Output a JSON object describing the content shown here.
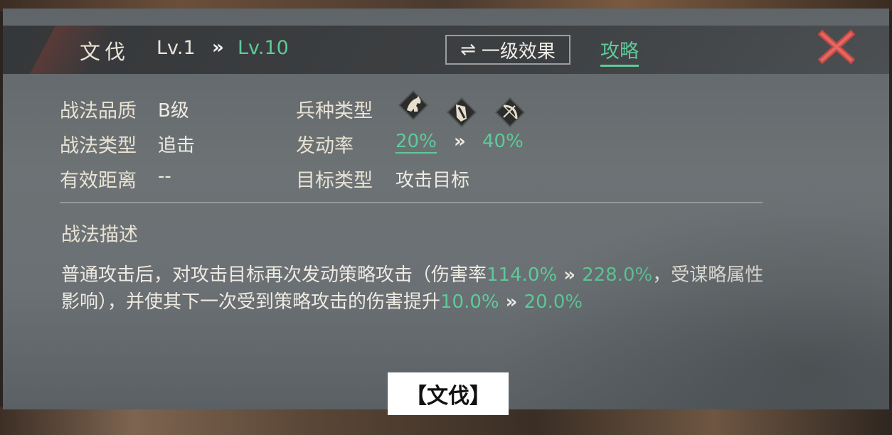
{
  "header": {
    "skill_name": "文伐",
    "level_from": "Lv.1",
    "level_arrow": "»",
    "level_to": "Lv.10",
    "effect_button": {
      "icon": "⇌",
      "label": "一级效果"
    },
    "strategy_link": "攻略",
    "close_icon": "close-icon"
  },
  "attributes": {
    "quality_label": "战法品质",
    "quality_value": "B级",
    "type_label": "战法类型",
    "type_value": "追击",
    "range_label": "有效距离",
    "range_value": "--",
    "troop_label": "兵种类型",
    "troop_icons": [
      "cavalry-icon",
      "shield-icon",
      "archer-icon"
    ],
    "rate_label": "发动率",
    "rate_from": "20%",
    "rate_arrow": "»",
    "rate_to": "40%",
    "target_label": "目标类型",
    "target_value": "攻击目标"
  },
  "description": {
    "title": "战法描述",
    "part1": "普通攻击后，对攻击目标再次发动策略攻击（伤害率",
    "dmg_from": "114.0%",
    "arrow1": " » ",
    "dmg_to": "228.0%",
    "part2": "，受谋略属性影响），并使其下一次受到策略攻击的伤害提升",
    "boost_from": "10.0%",
    "arrow2": " » ",
    "boost_to": "20.0%"
  },
  "caption": "【文伐】",
  "colors": {
    "accent_green": "#5fc99a",
    "close_red": "#d9534f"
  }
}
